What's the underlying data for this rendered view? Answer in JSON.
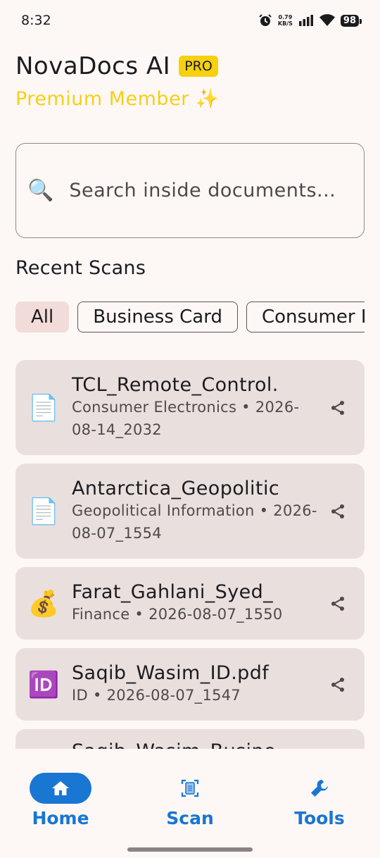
{
  "status": {
    "time": "8:32",
    "net_speed_value": "0.79",
    "net_speed_unit": "KB/S",
    "battery": "98"
  },
  "header": {
    "app_title": "NovaDocs AI",
    "badge": "PRO",
    "membership": "Premium Member ✨"
  },
  "search": {
    "placeholder": "Search inside documents..."
  },
  "recent": {
    "title": "Recent Scans",
    "filters": [
      "All",
      "Business Card",
      "Consumer Electronics"
    ],
    "active_filter": "All",
    "items": [
      {
        "icon": "📄",
        "icon_name": "document-icon",
        "title": "TCL_Remote_Control.",
        "subtitle": "Consumer Electronics • 2026-08-14_2032"
      },
      {
        "icon": "📄",
        "icon_name": "document-icon",
        "title": "Antarctica_Geopolitic",
        "subtitle": "Geopolitical Information • 2026-08-07_1554"
      },
      {
        "icon": "💰",
        "icon_name": "money-bag-icon",
        "title": "Farat_Gahlani_Syed_",
        "subtitle": "Finance • 2026-08-07_1550"
      },
      {
        "icon": "🆔",
        "icon_name": "id-icon",
        "title": "Saqib_Wasim_ID.pdf",
        "subtitle": "ID • 2026-08-07_1547"
      },
      {
        "icon": "",
        "icon_name": "",
        "title": "Saqib_Wasim_Busine",
        "subtitle": ""
      }
    ]
  },
  "nav": {
    "home": "Home",
    "scan": "Scan",
    "tools": "Tools",
    "active": "Home",
    "accent": "#1976d2"
  }
}
